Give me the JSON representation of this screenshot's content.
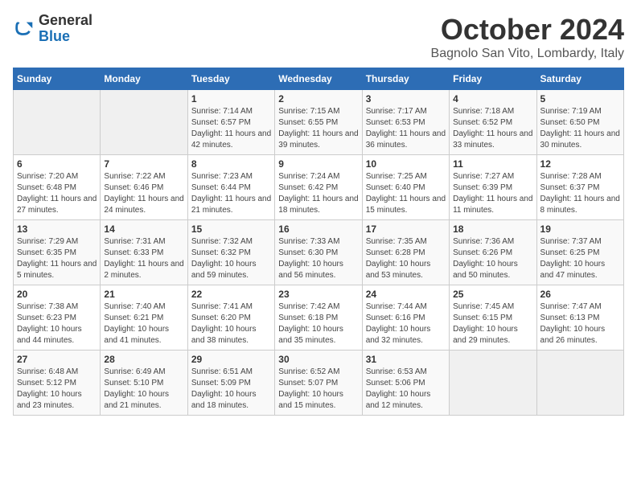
{
  "header": {
    "logo_line1": "General",
    "logo_line2": "Blue",
    "month": "October 2024",
    "location": "Bagnolo San Vito, Lombardy, Italy"
  },
  "days_of_week": [
    "Sunday",
    "Monday",
    "Tuesday",
    "Wednesday",
    "Thursday",
    "Friday",
    "Saturday"
  ],
  "weeks": [
    [
      {
        "day": "",
        "content": ""
      },
      {
        "day": "",
        "content": ""
      },
      {
        "day": "1",
        "content": "Sunrise: 7:14 AM\nSunset: 6:57 PM\nDaylight: 11 hours and 42 minutes."
      },
      {
        "day": "2",
        "content": "Sunrise: 7:15 AM\nSunset: 6:55 PM\nDaylight: 11 hours and 39 minutes."
      },
      {
        "day": "3",
        "content": "Sunrise: 7:17 AM\nSunset: 6:53 PM\nDaylight: 11 hours and 36 minutes."
      },
      {
        "day": "4",
        "content": "Sunrise: 7:18 AM\nSunset: 6:52 PM\nDaylight: 11 hours and 33 minutes."
      },
      {
        "day": "5",
        "content": "Sunrise: 7:19 AM\nSunset: 6:50 PM\nDaylight: 11 hours and 30 minutes."
      }
    ],
    [
      {
        "day": "6",
        "content": "Sunrise: 7:20 AM\nSunset: 6:48 PM\nDaylight: 11 hours and 27 minutes."
      },
      {
        "day": "7",
        "content": "Sunrise: 7:22 AM\nSunset: 6:46 PM\nDaylight: 11 hours and 24 minutes."
      },
      {
        "day": "8",
        "content": "Sunrise: 7:23 AM\nSunset: 6:44 PM\nDaylight: 11 hours and 21 minutes."
      },
      {
        "day": "9",
        "content": "Sunrise: 7:24 AM\nSunset: 6:42 PM\nDaylight: 11 hours and 18 minutes."
      },
      {
        "day": "10",
        "content": "Sunrise: 7:25 AM\nSunset: 6:40 PM\nDaylight: 11 hours and 15 minutes."
      },
      {
        "day": "11",
        "content": "Sunrise: 7:27 AM\nSunset: 6:39 PM\nDaylight: 11 hours and 11 minutes."
      },
      {
        "day": "12",
        "content": "Sunrise: 7:28 AM\nSunset: 6:37 PM\nDaylight: 11 hours and 8 minutes."
      }
    ],
    [
      {
        "day": "13",
        "content": "Sunrise: 7:29 AM\nSunset: 6:35 PM\nDaylight: 11 hours and 5 minutes."
      },
      {
        "day": "14",
        "content": "Sunrise: 7:31 AM\nSunset: 6:33 PM\nDaylight: 11 hours and 2 minutes."
      },
      {
        "day": "15",
        "content": "Sunrise: 7:32 AM\nSunset: 6:32 PM\nDaylight: 10 hours and 59 minutes."
      },
      {
        "day": "16",
        "content": "Sunrise: 7:33 AM\nSunset: 6:30 PM\nDaylight: 10 hours and 56 minutes."
      },
      {
        "day": "17",
        "content": "Sunrise: 7:35 AM\nSunset: 6:28 PM\nDaylight: 10 hours and 53 minutes."
      },
      {
        "day": "18",
        "content": "Sunrise: 7:36 AM\nSunset: 6:26 PM\nDaylight: 10 hours and 50 minutes."
      },
      {
        "day": "19",
        "content": "Sunrise: 7:37 AM\nSunset: 6:25 PM\nDaylight: 10 hours and 47 minutes."
      }
    ],
    [
      {
        "day": "20",
        "content": "Sunrise: 7:38 AM\nSunset: 6:23 PM\nDaylight: 10 hours and 44 minutes."
      },
      {
        "day": "21",
        "content": "Sunrise: 7:40 AM\nSunset: 6:21 PM\nDaylight: 10 hours and 41 minutes."
      },
      {
        "day": "22",
        "content": "Sunrise: 7:41 AM\nSunset: 6:20 PM\nDaylight: 10 hours and 38 minutes."
      },
      {
        "day": "23",
        "content": "Sunrise: 7:42 AM\nSunset: 6:18 PM\nDaylight: 10 hours and 35 minutes."
      },
      {
        "day": "24",
        "content": "Sunrise: 7:44 AM\nSunset: 6:16 PM\nDaylight: 10 hours and 32 minutes."
      },
      {
        "day": "25",
        "content": "Sunrise: 7:45 AM\nSunset: 6:15 PM\nDaylight: 10 hours and 29 minutes."
      },
      {
        "day": "26",
        "content": "Sunrise: 7:47 AM\nSunset: 6:13 PM\nDaylight: 10 hours and 26 minutes."
      }
    ],
    [
      {
        "day": "27",
        "content": "Sunrise: 6:48 AM\nSunset: 5:12 PM\nDaylight: 10 hours and 23 minutes."
      },
      {
        "day": "28",
        "content": "Sunrise: 6:49 AM\nSunset: 5:10 PM\nDaylight: 10 hours and 21 minutes."
      },
      {
        "day": "29",
        "content": "Sunrise: 6:51 AM\nSunset: 5:09 PM\nDaylight: 10 hours and 18 minutes."
      },
      {
        "day": "30",
        "content": "Sunrise: 6:52 AM\nSunset: 5:07 PM\nDaylight: 10 hours and 15 minutes."
      },
      {
        "day": "31",
        "content": "Sunrise: 6:53 AM\nSunset: 5:06 PM\nDaylight: 10 hours and 12 minutes."
      },
      {
        "day": "",
        "content": ""
      },
      {
        "day": "",
        "content": ""
      }
    ]
  ]
}
